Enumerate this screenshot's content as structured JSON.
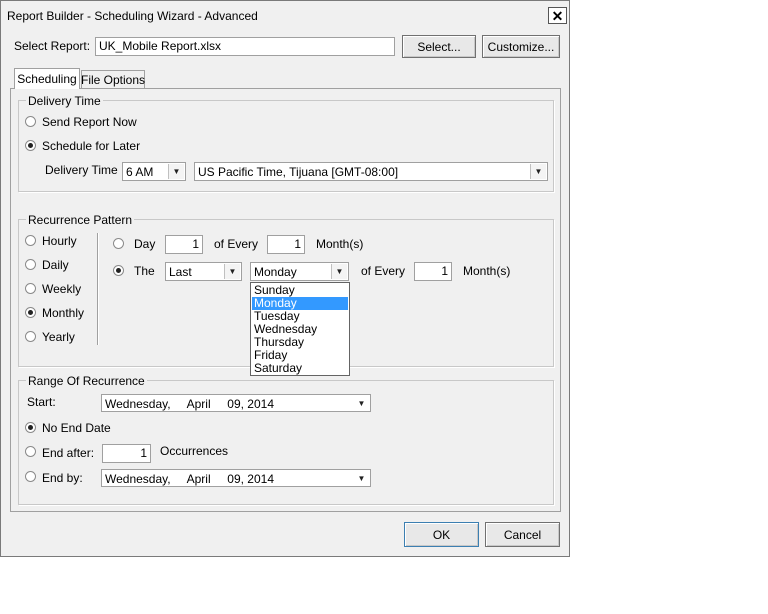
{
  "window": {
    "title": "Report Builder - Scheduling Wizard - Advanced",
    "close_glyph": "✕"
  },
  "report": {
    "label": "Select Report:",
    "value": "UK_Mobile Report.xlsx",
    "select_button": "Select...",
    "customize_button": "Customize..."
  },
  "tabs": [
    {
      "label": "Scheduling",
      "active": true
    },
    {
      "label": "File Options",
      "active": false
    }
  ],
  "delivery": {
    "group_title": "Delivery Time",
    "send_now": "Send Report Now",
    "schedule_later": "Schedule for Later",
    "selected": "schedule_later",
    "time_label": "Delivery Time",
    "time_value": "6 AM",
    "timezone_value": "US Pacific Time, Tijuana [GMT-08:00]"
  },
  "recurrence": {
    "group_title": "Recurrence Pattern",
    "frequencies": [
      {
        "label": "Hourly",
        "selected": false
      },
      {
        "label": "Daily",
        "selected": false
      },
      {
        "label": "Weekly",
        "selected": false
      },
      {
        "label": "Monthly",
        "selected": true
      },
      {
        "label": "Yearly",
        "selected": false
      }
    ],
    "day_option": {
      "label": "Day",
      "day_value": "1",
      "of_every": "of Every",
      "months_value": "1",
      "unit": "Month(s)"
    },
    "the_option": {
      "label": "The",
      "ordinal_value": "Last",
      "weekday_value": "Monday",
      "of_every": "of Every",
      "months_value": "1",
      "unit": "Month(s)"
    },
    "weekday_options": [
      "Sunday",
      "Monday",
      "Tuesday",
      "Wednesday",
      "Thursday",
      "Friday",
      "Saturday"
    ],
    "highlighted_option": "Monday"
  },
  "range": {
    "group_title": "Range Of Recurrence",
    "start_label": "Start:",
    "start_value": "Wednesday,     April     09, 2014",
    "no_end": "No End Date",
    "end_after": "End after:",
    "occurrences_value": "1",
    "occurrences_label": "Occurrences",
    "end_by": "End by:",
    "end_by_value": "Wednesday,     April     09, 2014",
    "selected": "no_end"
  },
  "footer": {
    "ok": "OK",
    "cancel": "Cancel"
  },
  "icons": {
    "dropdown_arrow": "▼"
  }
}
